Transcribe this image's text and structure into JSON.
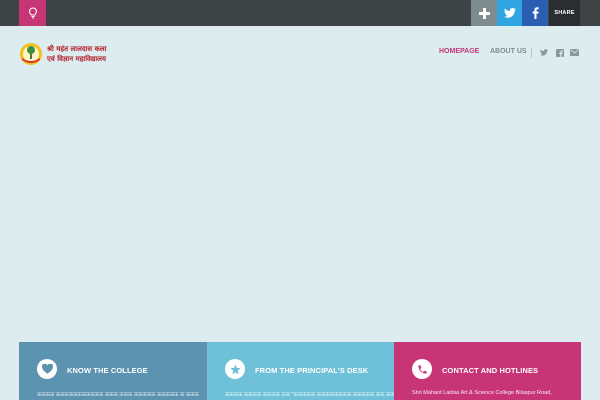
{
  "topbar": {
    "share_label": "SHARE",
    "icons": [
      "lightbulb-icon",
      "plus-icon",
      "twitter-icon",
      "facebook-icon"
    ]
  },
  "header": {
    "logo_line1": "श्री महंत लालदास कला",
    "logo_line2": "एवं विज्ञान महाविद्यालय"
  },
  "nav": {
    "items": [
      {
        "label": "HOMEPAGE",
        "active": true
      },
      {
        "label": "ABOUT US",
        "active": false
      }
    ],
    "social_icons": [
      "twitter-icon",
      "facebook-icon",
      "mail-icon"
    ]
  },
  "boxes": [
    {
      "title": "KNOW THE COLLEGE",
      "icon": "heart-icon",
      "text": "ऊऊऊऊ ऊऊऊऊऊऊऊऊऊऊऊ ऊऊऊ ऊऊऊ ऊऊऊऊऊ ऊऊऊऊऊ ऊ ऊऊऊ",
      "color": "#5b93b1"
    },
    {
      "title": "FROM THE PRINCIPAL'S DESK",
      "icon": "star-icon",
      "text": "ऊऊऊऊ ऊऊऊऊ ऊऊऊऊ ऊऊ \"ऊऊऊऊऊ ऊऊऊऊऊऊऊऊ ऊऊऊऊऊ ऊऊ ऊऊऊ",
      "color": "#6fc1d9"
    },
    {
      "title": "CONTACT AND HOTLINES",
      "icon": "phone-icon",
      "text": "Shri Mahant Laldas Art & Science College Bilaspur Road,",
      "color": "#c73577"
    }
  ],
  "colors": {
    "accent": "#c73577",
    "topbar": "#3e4446",
    "background": "#dcecef"
  }
}
